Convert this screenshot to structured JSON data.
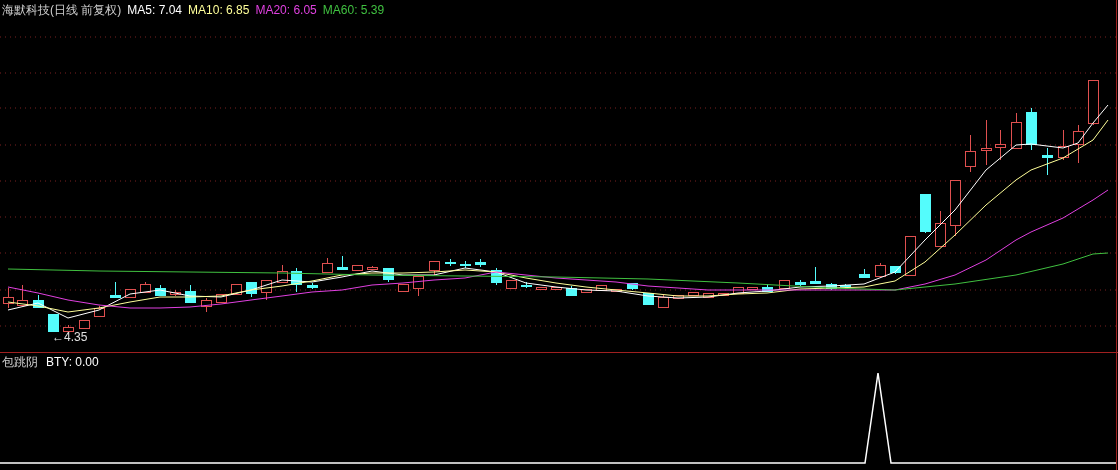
{
  "main_panel": {
    "title": "海默科技(日线 前复权)",
    "indicators": [
      {
        "label": "MA5: 7.04",
        "color": "#ffffff"
      },
      {
        "label": "MA10: 6.85",
        "color": "#ffff99"
      },
      {
        "label": "MA20: 6.05",
        "color": "#e040e0"
      },
      {
        "label": "MA60: 5.39",
        "color": "#40c040"
      }
    ],
    "low_label": "←4.35"
  },
  "sub_panel": {
    "title": "包跳阴",
    "indicators": [
      {
        "label": "BTY: 0.00",
        "color": "#ffffff"
      }
    ]
  }
}
